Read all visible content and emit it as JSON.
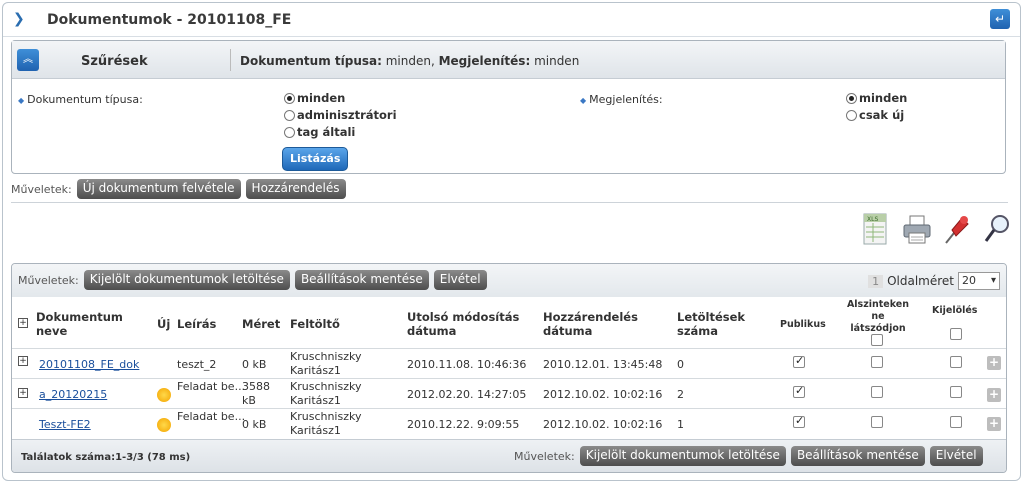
{
  "header": {
    "title": "Dokumentumok - 20101108_FE"
  },
  "filter": {
    "label": "Szűrések",
    "summary_k1": "Dokumentum típusa:",
    "summary_v1": " minden, ",
    "summary_k2": "Megjelenítés:",
    "summary_v2": " minden",
    "doc_type_label": "Dokumentum típusa:",
    "doc_type_options": [
      "minden",
      "adminisztrátori",
      "tag általi"
    ],
    "display_label": "Megjelenítés:",
    "display_options": [
      "minden",
      "csak új"
    ],
    "list_button": "Listázás"
  },
  "top_ops": {
    "label": "Műveletek:",
    "new_doc": "Új dokumentum felvétele",
    "assign": "Hozzárendelés"
  },
  "grid": {
    "ops_label": "Műveletek:",
    "download_selected": "Kijelölt dokumentumok letöltése",
    "save_settings": "Beállítások mentése",
    "remove": "Elvétel",
    "page_number": "1",
    "page_size_label": "Oldalméret",
    "page_size": "20",
    "columns": {
      "name_1": "Dokumentum",
      "name_2": "neve",
      "new": "Új",
      "desc": "Leírás",
      "size": "Méret",
      "uploader": "Feltöltő",
      "modified_1": "Utolsó módosítás",
      "modified_2": "dátuma",
      "assigned_1": "Hozzárendelés",
      "assigned_2": "dátuma",
      "downloads_1": "Letöltések",
      "downloads_2": "száma",
      "public": "Publikus",
      "hidden_1": "Alszinteken ne",
      "hidden_2": "látszódjon",
      "select": "Kijelölés"
    },
    "rows": [
      {
        "name": "20101108_FE_dok",
        "desc": "teszt_2",
        "size1": "0 kB",
        "size2": "",
        "up1": "Kruschniszky",
        "up2": "Karitász1",
        "modified": "2010.11.08. 10:46:36",
        "assigned": "2010.12.01. 13:45:48",
        "downloads": "0",
        "is_new": false
      },
      {
        "name": "a_20120215",
        "desc": "Feladat be...",
        "size1": "3588",
        "size2": "kB",
        "up1": "Kruschniszky",
        "up2": "Karitász1",
        "modified": "2012.02.20. 14:27:05",
        "assigned": "2012.10.02. 10:02:16",
        "downloads": "2",
        "is_new": true
      },
      {
        "name": "Teszt-FE2",
        "desc": "Feladat be...",
        "size1": "0 kB",
        "size2": "",
        "up1": "Kruschniszky",
        "up2": "Karitász1",
        "modified": "2010.12.22. 9:09:55",
        "assigned": "2012.10.02. 10:02:16",
        "downloads": "1",
        "is_new": true
      }
    ],
    "results": "Találatok száma:1-3/3 (78 ms)"
  }
}
